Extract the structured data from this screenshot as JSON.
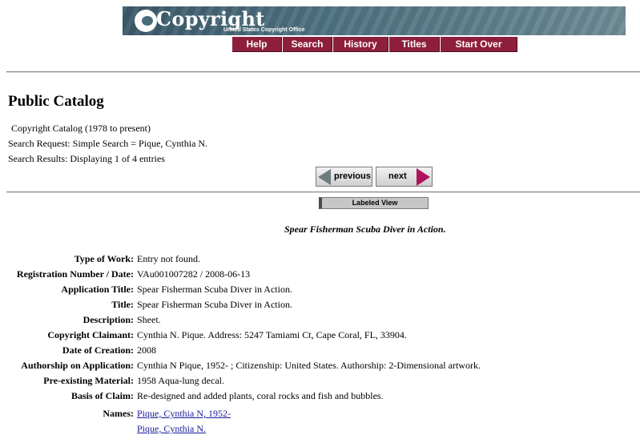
{
  "header": {
    "logo_word": "Copyright",
    "logo_subtitle": "United States Copyright Office"
  },
  "nav": {
    "help": "Help",
    "search": "Search",
    "history": "History",
    "titles": "Titles",
    "start_over": "Start Over"
  },
  "page": {
    "title": "Public Catalog",
    "catalog": "Copyright Catalog (1978 to present)",
    "search_request": "Search Request: Simple Search = Pique, Cynthia N.",
    "search_results": "Search Results: Displaying 1 of 4 entries"
  },
  "pager": {
    "previous": "previous",
    "next": "next"
  },
  "view": {
    "label": "Labeled View"
  },
  "record": {
    "title": "Spear Fisherman Scuba Diver in Action.",
    "fields": [
      {
        "label": "Type of Work:",
        "value": "Entry not found."
      },
      {
        "label": "Registration Number / Date:",
        "value": "VAu001007282 / 2008-06-13"
      },
      {
        "label": "Application Title:",
        "value": "Spear Fisherman Scuba Diver in Action."
      },
      {
        "label": "Title:",
        "value": "Spear Fisherman Scuba Diver in Action."
      },
      {
        "label": "Description:",
        "value": "Sheet."
      },
      {
        "label": "Copyright Claimant:",
        "value": "Cynthia N. Pique. Address: 5247 Tamiami Ct, Cape Coral, FL, 33904."
      },
      {
        "label": "Date of Creation:",
        "value": "2008"
      },
      {
        "label": "Authorship on Application:",
        "value": "Cynthia N Pique, 1952- ; Citizenship: United States. Authorship: 2-Dimensional artwork."
      },
      {
        "label": "Pre-existing Material:",
        "value": "1958 Aqua-lung decal."
      },
      {
        "label": "Basis of Claim:",
        "value": "Re-designed and added plants, coral rocks and fish and bubbles."
      }
    ],
    "names_label": "Names:",
    "names": [
      "Pique, Cynthia N, 1952-",
      "Pique, Cynthia N."
    ]
  }
}
